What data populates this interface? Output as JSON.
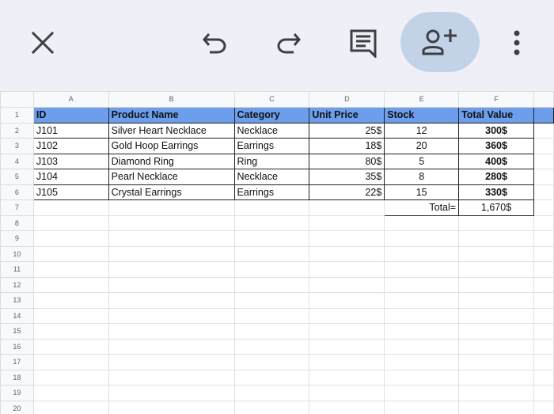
{
  "toolbar": {
    "icons": [
      "close-icon",
      "undo-icon",
      "redo-icon",
      "comment-icon",
      "add-person-icon",
      "more-vert-icon"
    ],
    "colors": {
      "background": "#eff0f7",
      "share_highlight": "#c2d3e7",
      "icon": "#3c4043"
    }
  },
  "sheet": {
    "columns": [
      "A",
      "B",
      "C",
      "D",
      "E",
      "F"
    ],
    "header_fill": "#6d9eeb",
    "headers": [
      "ID",
      "Product Name",
      "Category",
      "Unit Price",
      "Stock",
      "Total Value"
    ],
    "rows": [
      {
        "id": "J101",
        "name": "Silver Heart Necklace",
        "category": "Necklace",
        "price": "25$",
        "stock": "12",
        "total": "300$"
      },
      {
        "id": "J102",
        "name": "Gold Hoop Earrings",
        "category": "Earrings",
        "price": "18$",
        "stock": "20",
        "total": "360$"
      },
      {
        "id": "J103",
        "name": "Diamond Ring",
        "category": "Ring",
        "price": "80$",
        "stock": "5",
        "total": "400$"
      },
      {
        "id": "J104",
        "name": "Pearl Necklace",
        "category": "Necklace",
        "price": "35$",
        "stock": "8",
        "total": "280$"
      },
      {
        "id": "J105",
        "name": "Crystal Earrings",
        "category": "Earrings",
        "price": "22$",
        "stock": "15",
        "total": "330$"
      }
    ],
    "total_label": "Total=",
    "total_value": "1,670$",
    "row_numbers": [
      "1",
      "2",
      "3",
      "4",
      "5",
      "6",
      "7",
      "8",
      "9",
      "10",
      "11",
      "12",
      "13",
      "14",
      "15",
      "16",
      "17",
      "18",
      "19",
      "20"
    ]
  }
}
